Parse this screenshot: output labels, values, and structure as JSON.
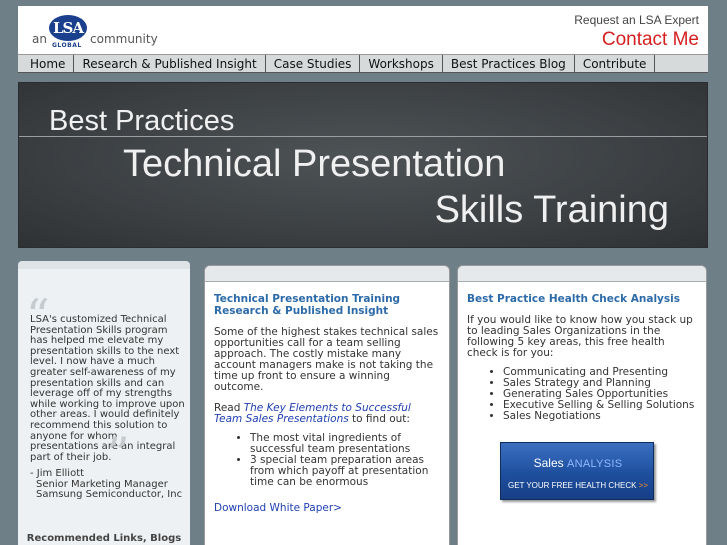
{
  "header": {
    "logo_an": "an",
    "logo_mark": "LSA",
    "logo_global": "GLOBAL",
    "logo_community": "community",
    "request_label": "Request an LSA Expert",
    "contact_label": "Contact Me"
  },
  "nav": {
    "items": [
      "Home",
      "Research & Published Insight",
      "Case Studies",
      "Workshops",
      "Best Practices Blog",
      "Contribute"
    ]
  },
  "banner": {
    "line1": "Best Practices",
    "line2": "Technical Presentation",
    "line3": "Skills Training"
  },
  "testimonial": {
    "quote": "LSA's customized Technical Presentation Skills program has helped me elevate my presentation skills to the next level. I now have a much greater self-awareness of my presentation skills and can leverage off of my strengths while working to improve upon other areas. I would definitely recommend this solution to anyone for whom presentations are an integral part of their job.",
    "name": "- Jim Elliott",
    "title": "Senior Marketing Manager",
    "company": "Samsung Semiconductor, Inc",
    "recommended": "Recommended Links, Blogs"
  },
  "middle_card": {
    "heading": "Technical Presentation Training Research & Published Insight",
    "intro": "Some of the highest stakes technical sales opportunities call for a team selling approach. The costly mistake many account managers make is not taking the time up front to ensure a winning outcome.",
    "read_prefix": "Read ",
    "read_link": "The Key Elements to Successful Team Sales Presentations",
    "read_suffix": " to find out:",
    "bullets": [
      "The most vital ingredients of successful team presentations",
      "3 special team preparation areas from which payoff at presentation time can be enormous"
    ],
    "download_link": "Download White Paper>"
  },
  "right_card": {
    "heading": "Best Practice Health Check Analysis",
    "intro": "If you would like to know how you stack up to leading Sales Organizations in the following 5 key areas, this free health check is for you:",
    "bullets": [
      "Communicating and Presenting",
      "Sales Strategy and Planning",
      "Generating Sales Opportunities",
      "Executive Selling & Selling Solutions",
      "Sales Negotiations"
    ],
    "button_word1": "Sales",
    "button_word2": "ANALYSIS",
    "button_cta": "GET YOUR FREE HEALTH CHECK",
    "button_arrows": ">>"
  },
  "colors": {
    "accent_blue": "#2c6aa8",
    "contact_red": "#d62020",
    "page_bg": "#6f7f88"
  }
}
